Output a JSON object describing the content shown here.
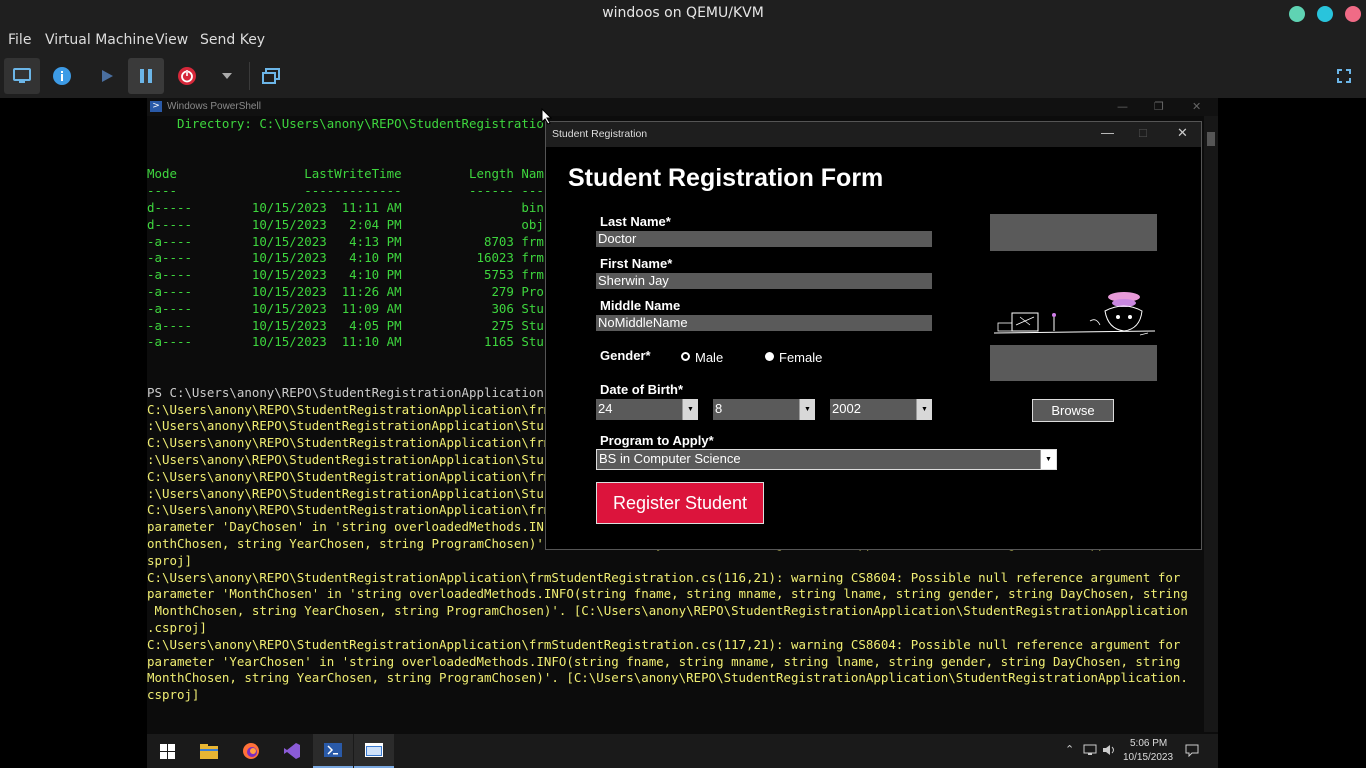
{
  "host": {
    "title": "windoos on QEMU/KVM",
    "menu": [
      "File",
      "Virtual Machine",
      "View",
      "Send Key"
    ],
    "window_controls": [
      "#5fd3b3",
      "#29c4dc",
      "#f06b86"
    ],
    "toolbar_icons": [
      "display-icon",
      "info-icon",
      "play-icon",
      "pause-icon",
      "power-icon",
      "chevron-down-icon",
      "snapshots-icon",
      "fullscreen-icon"
    ]
  },
  "powershell": {
    "title": "Windows PowerShell",
    "lines": [
      {
        "t": "    Directory: C:\\Users\\anony\\REPO\\StudentRegistratio",
        "c": "g"
      },
      {
        "t": "",
        "c": "g"
      },
      {
        "t": "",
        "c": "g"
      },
      {
        "t": "Mode                 LastWriteTime         Length Nam",
        "c": "g"
      },
      {
        "t": "----                 -------------         ------ ---",
        "c": "g"
      },
      {
        "t": "d-----        10/15/2023  11:11 AM                bin",
        "c": "g"
      },
      {
        "t": "d-----        10/15/2023   2:04 PM                obj",
        "c": "g"
      },
      {
        "t": "-a----        10/15/2023   4:13 PM           8703 frm",
        "c": "g"
      },
      {
        "t": "-a----        10/15/2023   4:10 PM          16023 frm",
        "c": "g"
      },
      {
        "t": "-a----        10/15/2023   4:10 PM           5753 frm",
        "c": "g"
      },
      {
        "t": "-a----        10/15/2023  11:26 AM            279 Pro",
        "c": "g"
      },
      {
        "t": "-a----        10/15/2023  11:09 AM            306 Stu",
        "c": "g"
      },
      {
        "t": "-a----        10/15/2023   4:05 PM            275 Stu",
        "c": "g"
      },
      {
        "t": "-a----        10/15/2023  11:10 AM           1165 Stu",
        "c": "g"
      },
      {
        "t": "",
        "c": "g"
      },
      {
        "t": "",
        "c": "g"
      },
      {
        "t": "PS C:\\Users\\anony\\REPO\\StudentRegistrationApplication",
        "c": "w"
      },
      {
        "t": "C:\\Users\\anony\\REPO\\StudentRegistrationApplication\\frm",
        "c": "y"
      },
      {
        "t": ":\\Users\\anony\\REPO\\StudentRegistrationApplication\\Stu",
        "c": "y"
      },
      {
        "t": "C:\\Users\\anony\\REPO\\StudentRegistrationApplication\\frm",
        "c": "y"
      },
      {
        "t": ":\\Users\\anony\\REPO\\StudentRegistrationApplication\\Stu",
        "c": "y"
      },
      {
        "t": "C:\\Users\\anony\\REPO\\StudentRegistrationApplication\\frm",
        "c": "y"
      },
      {
        "t": ":\\Users\\anony\\REPO\\StudentRegistrationApplication\\Stu",
        "c": "y"
      },
      {
        "t": "C:\\Users\\anony\\REPO\\StudentRegistrationApplication\\frm",
        "c": "y"
      },
      {
        "t": "parameter 'DayChosen' in 'string overloadedMethods.IN",
        "c": "y"
      },
      {
        "t": "onthChosen, string YearChosen, string ProgramChosen)' [C:\\Users\\anony\\REPO\\StudentRegistrationApplication\\StudentRegistrationApplication.c",
        "c": "y"
      },
      {
        "t": "sproj]",
        "c": "y"
      },
      {
        "t": "C:\\Users\\anony\\REPO\\StudentRegistrationApplication\\frmStudentRegistration.cs(116,21): warning CS8604: Possible null reference argument for",
        "c": "y"
      },
      {
        "t": "parameter 'MonthChosen' in 'string overloadedMethods.INFO(string fname, string mname, string lname, string gender, string DayChosen, string",
        "c": "y"
      },
      {
        "t": " MonthChosen, string YearChosen, string ProgramChosen)'. [C:\\Users\\anony\\REPO\\StudentRegistrationApplication\\StudentRegistrationApplication",
        "c": "y"
      },
      {
        "t": ".csproj]",
        "c": "y"
      },
      {
        "t": "C:\\Users\\anony\\REPO\\StudentRegistrationApplication\\frmStudentRegistration.cs(117,21): warning CS8604: Possible null reference argument for",
        "c": "y"
      },
      {
        "t": "parameter 'YearChosen' in 'string overloadedMethods.INFO(string fname, string mname, string lname, string gender, string DayChosen, string",
        "c": "y"
      },
      {
        "t": "MonthChosen, string YearChosen, string ProgramChosen)'. [C:\\Users\\anony\\REPO\\StudentRegistrationApplication\\StudentRegistrationApplication.",
        "c": "y"
      },
      {
        "t": "csproj]",
        "c": "y"
      }
    ],
    "colors": {
      "g": "#3ed63e",
      "y": "#f0ee73",
      "w": "#cccccc"
    }
  },
  "form": {
    "title": "Student Registration",
    "heading": "Student Registration Form",
    "last_name_label": "Last Name*",
    "last_name_value": "Doctor",
    "first_name_label": "First Name*",
    "first_name_value": "Sherwin Jay",
    "middle_name_label": "Middle Name",
    "middle_name_value": "NoMiddleName",
    "gender_label": "Gender*",
    "gender_options": [
      "Male",
      "Female"
    ],
    "gender_selected": "Male",
    "dob_label": "Date of Birth*",
    "dob_day": "24",
    "dob_month": "8",
    "dob_year": "2002",
    "program_label": "Program to Apply*",
    "program_value": "BS in Computer Science",
    "browse_label": "Browse",
    "register_label": "Register Student",
    "register_color": "#dc143c"
  },
  "taskbar": {
    "apps": [
      "windows-start-icon",
      "file-explorer-icon",
      "firefox-icon",
      "visual-studio-icon",
      "powershell-icon",
      "app-window-icon"
    ],
    "time": "5:06 PM",
    "date": "10/15/2023"
  }
}
